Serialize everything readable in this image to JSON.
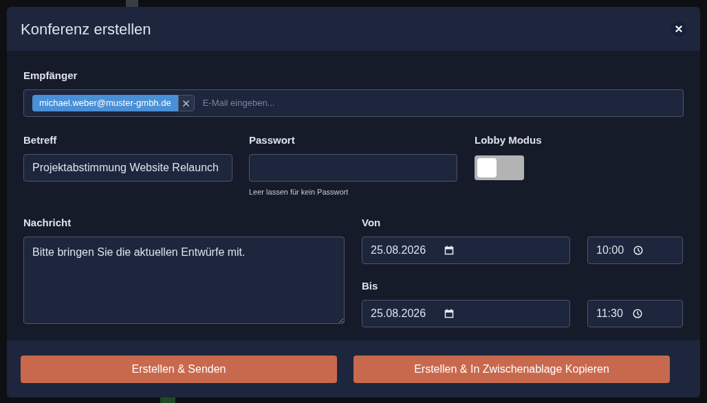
{
  "dialog": {
    "title": "Konferenz erstellen",
    "recipients": {
      "label": "Empfänger",
      "chips": [
        {
          "text": "michael.weber@muster-gmbh.de"
        }
      ],
      "placeholder": "E-Mail eingeben..."
    },
    "subject": {
      "label": "Betreff",
      "value": "Projektabstimmung Website Relaunch"
    },
    "password": {
      "label": "Passwort",
      "hint": "Leer lassen für kein Passwort"
    },
    "lobby": {
      "label": "Lobby Modus",
      "on": false
    },
    "message": {
      "label": "Nachricht",
      "value": "Bitte bringen Sie die aktuellen Entwürfe mit."
    },
    "from": {
      "label": "Von",
      "date": "25.08.2026",
      "time": "10:00"
    },
    "to": {
      "label": "Bis",
      "date": "25.08.2026",
      "time": "11:30"
    },
    "buttons": [
      "Erstellen & Senden",
      "Erstellen & In Zwischenablage Kopieren"
    ]
  }
}
